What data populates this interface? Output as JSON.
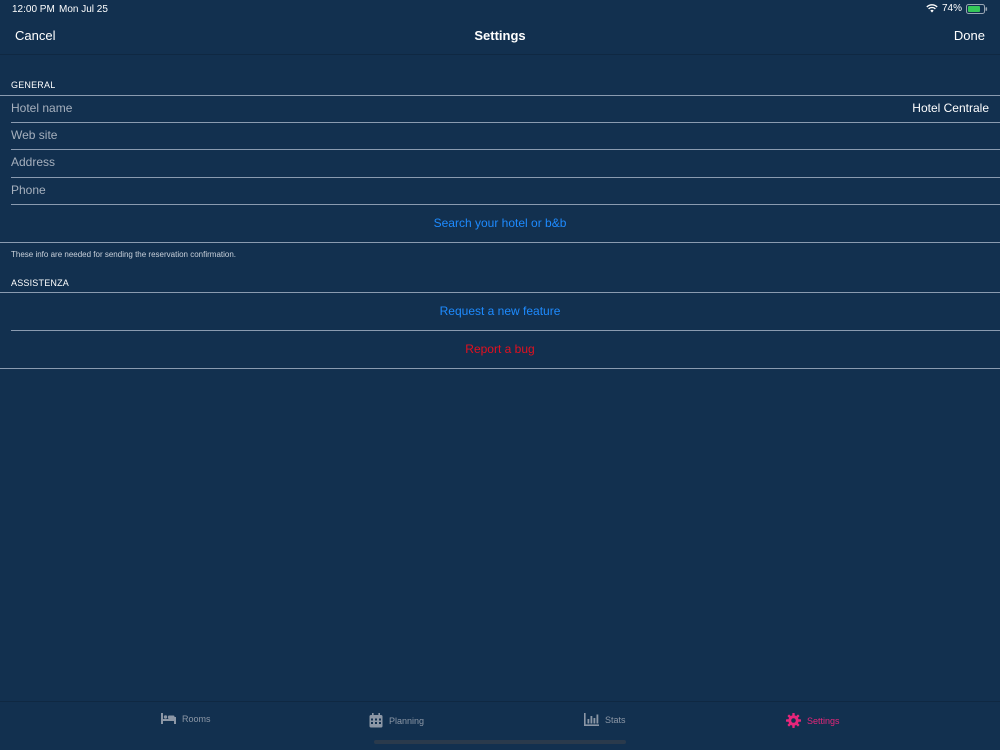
{
  "status_bar": {
    "time": "12:00 PM",
    "date": "Mon Jul 25",
    "battery": "74%"
  },
  "nav": {
    "cancel": "Cancel",
    "title": "Settings",
    "done": "Done"
  },
  "general": {
    "header": "GENERAL",
    "fields": [
      {
        "label": "Hotel name",
        "value": "Hotel Centrale"
      },
      {
        "label": "Web site",
        "value": ""
      },
      {
        "label": "Address",
        "value": ""
      },
      {
        "label": "Phone",
        "value": ""
      }
    ],
    "search_action": "Search your hotel or b&b",
    "footnote": "These info are needed for sending the reservation confirmation."
  },
  "assistenza": {
    "header": "ASSISTENZA",
    "request_feature": "Request a new feature",
    "report_bug": "Report a bug"
  },
  "tabs": [
    {
      "label": "Rooms",
      "icon": "bed-icon"
    },
    {
      "label": "Planning",
      "icon": "calendar-icon"
    },
    {
      "label": "Stats",
      "icon": "bar-chart-icon"
    },
    {
      "label": "Settings",
      "icon": "gear-icon",
      "active": true
    }
  ],
  "colors": {
    "background": "#12304f",
    "link_blue": "#1e8bff",
    "destructive_red": "#e3101f",
    "active_tab": "#e6267a",
    "inactive_tab": "#8c97a6"
  }
}
